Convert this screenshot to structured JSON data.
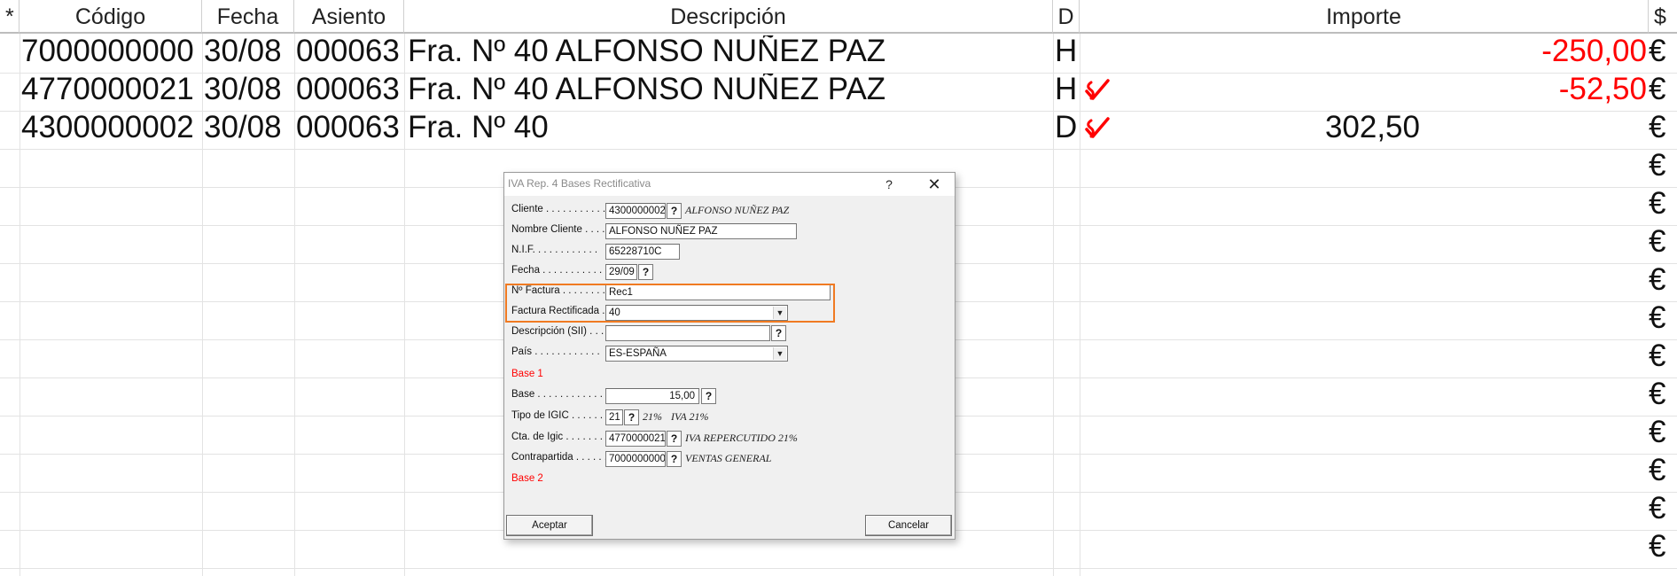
{
  "grid": {
    "headers": {
      "star": "*",
      "codigo": "Código",
      "fecha": "Fecha",
      "asiento": "Asiento",
      "descripcion": "Descripción",
      "d": "D",
      "importe": "Importe",
      "moneda": "$"
    },
    "rows": [
      {
        "codigo": "7000000000",
        "fecha": "30/08",
        "asiento": "000063",
        "descripcion": "Fra. Nº 40 ALFONSO NUÑEZ PAZ",
        "d": "H",
        "checked": false,
        "importe": "-250,00",
        "negative": true,
        "moneda": "€"
      },
      {
        "codigo": "4770000021",
        "fecha": "30/08",
        "asiento": "000063",
        "descripcion": "Fra. Nº 40 ALFONSO NUÑEZ PAZ",
        "d": "H",
        "checked": true,
        "importe": "-52,50",
        "negative": true,
        "moneda": "€"
      },
      {
        "codigo": "4300000002",
        "fecha": "30/08",
        "asiento": "000063",
        "descripcion": "Fra. Nº 40",
        "d": "D",
        "checked": true,
        "importe": "302,50",
        "negative": false,
        "moneda": "€"
      }
    ],
    "empty_row_currency": "€"
  },
  "dialog": {
    "title": "IVA Rep. 4 Bases Rectificativa",
    "help_label": "?",
    "close_label": "✕",
    "lookup_label": "?",
    "fields": {
      "cliente": {
        "label": "Cliente . . . . . . . . . . .",
        "value": "4300000002",
        "desc": "ALFONSO NUÑEZ PAZ"
      },
      "nombre_cliente": {
        "label": "Nombre Cliente . . . .",
        "value": "ALFONSO NUÑEZ PAZ"
      },
      "nif": {
        "label": "N.I.F. . . . . . . . . . . .",
        "value": "65228710C"
      },
      "fecha": {
        "label": "Fecha . . . . . . . . . . .",
        "value": "29/09"
      },
      "n_factura": {
        "label": "Nº Factura . . . . . . . .",
        "value": "Rec1"
      },
      "factura_rectificada": {
        "label": "Factura Rectificada .",
        "value": "40"
      },
      "descripcion_sii": {
        "label": "Descripción (SII) . . .",
        "value": ""
      },
      "pais": {
        "label": "País . . . . . . . . . . . .",
        "value": "ES-ESPAÑA"
      },
      "base": {
        "label": "Base . . . . . . . . . . . .",
        "value": "15,00"
      },
      "tipo_igic": {
        "label": "Tipo de IGIC . . . . . .",
        "value": "21",
        "desc1": "21%",
        "desc2": "IVA 21%"
      },
      "cta_igic": {
        "label": "Cta. de Igic . . . . . . .",
        "value": "4770000021",
        "desc": "IVA REPERCUTIDO 21%"
      },
      "contrapartida": {
        "label": "Contrapartida . . . . . .",
        "value": "7000000000",
        "desc": "VENTAS GENERAL"
      }
    },
    "sections": {
      "base1": "Base 1",
      "base2": "Base 2"
    },
    "buttons": {
      "aceptar": "Aceptar",
      "cancelar": "Cancelar"
    }
  },
  "colors": {
    "negative": "#ff0000",
    "highlight": "#f07a22",
    "section": "#ff0000"
  },
  "icons": {
    "checked": "check-cross-icon",
    "dropdown": "chevron-down-icon"
  }
}
